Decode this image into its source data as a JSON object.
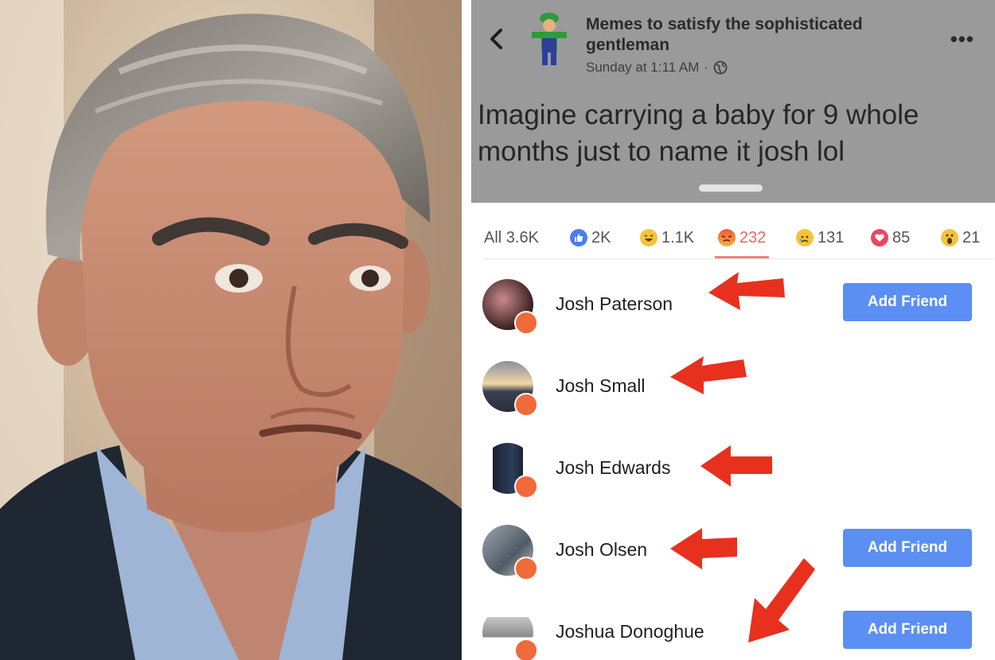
{
  "post": {
    "page_name": "Memes to satisfy the sophisticated gentleman",
    "timestamp": "Sunday at 1:11 AM",
    "visibility_icon": "globe-icon",
    "text": "Imagine carrying a baby for 9 whole months just to name it josh lol"
  },
  "reaction_tabs": [
    {
      "label": "All 3.6K",
      "icon": ""
    },
    {
      "label": "2K",
      "icon": "like-icon"
    },
    {
      "label": "1.1K",
      "icon": "haha-icon"
    },
    {
      "label": "232",
      "icon": "angry-icon",
      "active": true
    },
    {
      "label": "131",
      "icon": "sad-icon"
    },
    {
      "label": "85",
      "icon": "love-icon"
    },
    {
      "label": "21",
      "icon": "wow-icon"
    }
  ],
  "people": [
    {
      "name": "Josh Paterson",
      "button": "Add Friend"
    },
    {
      "name": "Josh Small",
      "button": ""
    },
    {
      "name": "Josh Edwards",
      "button": ""
    },
    {
      "name": "Josh Olsen",
      "button": "Add Friend"
    },
    {
      "name": "Joshua Donoghue",
      "button": "Add Friend"
    }
  ],
  "colors": {
    "accent_blue": "#5b8ff3",
    "angry": "#e26b5c",
    "arrow": "#e8301e"
  }
}
